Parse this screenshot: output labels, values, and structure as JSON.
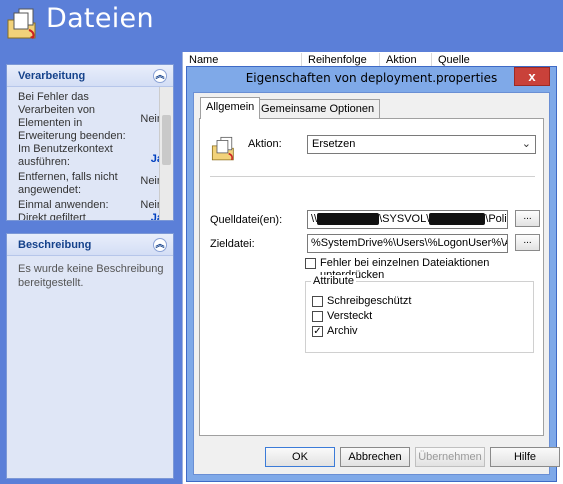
{
  "app": {
    "title": "Dateien",
    "icon": "files-copy-icon"
  },
  "panels": {
    "verarbeitung": {
      "title": "Verarbeitung",
      "collapse_icon": "chevron-up-icon",
      "rows": [
        {
          "label": "Bei Fehler das Verarbeiten von Elementen in Erweiterung beenden:",
          "value": "Nein"
        },
        {
          "label": "Im Benutzerkontext ausführen:",
          "value": "Ja"
        },
        {
          "label": "Entfernen, falls nicht angewendet:",
          "value": "Nein"
        },
        {
          "label": "Einmal anwenden:",
          "value": "Nein"
        },
        {
          "label": "Direkt gefiltert",
          "value": "Ja"
        }
      ]
    },
    "beschreibung": {
      "title": "Beschreibung",
      "collapse_icon": "chevron-up-icon",
      "text": "Es wurde keine Beschreibung bereitgestellt."
    }
  },
  "list": {
    "columns": [
      "Name",
      "Reihenfolge",
      "Aktion",
      "Quelle"
    ]
  },
  "dialog": {
    "title": "Eigenschaften von deployment.properties",
    "close_glyph": "x",
    "tabs": [
      "Allgemein",
      "Gemeinsame Optionen"
    ],
    "action_label": "Aktion:",
    "action_value": "Ersetzen",
    "source_label": "Quelldatei(en):",
    "source_value_parts": [
      "\\\\",
      "\\SYSVOL\\",
      "\\Policies"
    ],
    "target_label": "Zieldatei:",
    "target_value": "%SystemDrive%\\Users\\%LogonUser%\\AppD",
    "browse_label": "...",
    "suppress_errors_label": "Fehler bei einzelnen Dateiaktionen unterdrücken",
    "suppress_errors_checked": false,
    "attributes_title": "Attribute",
    "attributes": [
      {
        "label": "Schreibgeschützt",
        "checked": false
      },
      {
        "label": "Versteckt",
        "checked": false
      },
      {
        "label": "Archiv",
        "checked": true
      }
    ],
    "buttons": {
      "ok": "OK",
      "cancel": "Abbrechen",
      "apply": "Übernehmen",
      "help": "Hilfe"
    }
  }
}
